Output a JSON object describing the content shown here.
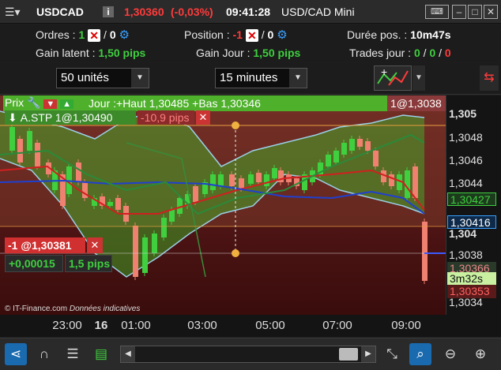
{
  "window": {
    "instrument": "USDCAD",
    "price": "1,30360",
    "change": "(-0,03%)",
    "time": "09:41:28",
    "title": "USD/CAD Mini",
    "info_icon": "i"
  },
  "info": {
    "orders_label": "Ordres :",
    "orders_open": "1",
    "orders_sep": "/",
    "orders_pending": "0",
    "position_label": "Position :",
    "position_value": "-1",
    "position_sep": "/",
    "position_pending": "0",
    "duration_label": "Durée pos. :",
    "duration_value": "10m47s",
    "latent_label": "Gain latent :",
    "latent_value": "1,50 pips",
    "daygain_label": "Gain Jour :",
    "daygain_value": "1,50 pips",
    "trades_label": "Trades jour :",
    "trades_a": "0",
    "trades_b": "0",
    "trades_c": "0",
    "trades_sep": "/"
  },
  "toolbar": {
    "units": "50 unités",
    "interval": "15 minutes"
  },
  "chart": {
    "top_label": "Prix",
    "day_label": "Jour :+Haut 1,30485 +Bas 1,30346",
    "last_tag": "1@1,3038",
    "stop_label": "A.STP 1@1,30490",
    "stop_dist": "-10,9 pips",
    "pos_label": "-1 @1,30381",
    "pos_delta": "+0,00015",
    "pos_pips": "1,5 pips",
    "copyright": "© IT-Finance.com",
    "disclaimer": "Données indicatives",
    "y_labels": [
      "1,305",
      "1,3048",
      "1,3046",
      "1,3044",
      "1,304",
      "1,3038",
      "1,3034"
    ],
    "y_tags": {
      "upper_band": "1,30427",
      "mid_band": "1,30416",
      "alt": "1,30366",
      "timer": "3m32s",
      "bid": "1,30353"
    },
    "x_labels": [
      "23:00",
      "16",
      "01:00",
      "03:00",
      "05:00",
      "07:00",
      "09:00"
    ]
  },
  "colors": {
    "green": "#3fcf3f",
    "red": "#ff3b3b",
    "blue": "#3aa0ff"
  }
}
